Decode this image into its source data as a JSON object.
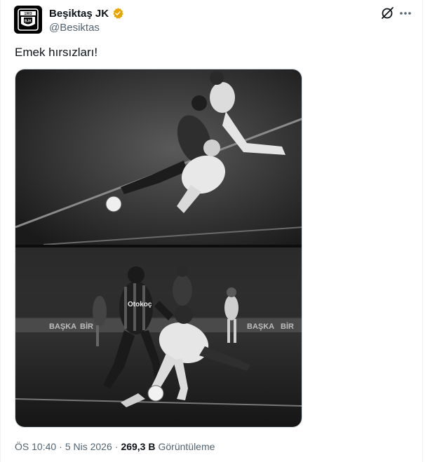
{
  "author": {
    "name": "Beşiktaş JK",
    "handle": "@Besiktas",
    "verified": true,
    "verified_color": "#f2b300"
  },
  "tweet": {
    "text": "Emek hırsızları!"
  },
  "media": {
    "description": "Black and white two-panel football photo collage",
    "crest_text": "BJK",
    "crest_year": "1903",
    "ads": [
      "BAŞKA",
      "BİR",
      "BAŞKA",
      "BİR"
    ],
    "sponsor": "Otokoç"
  },
  "meta": {
    "time": "ÖS 10:40",
    "separator": "·",
    "date": "5 Nis 2026",
    "views_count": "269,3 B",
    "views_label": "Görüntüleme"
  },
  "icons": {
    "grok": "grok-icon",
    "more": "more-icon",
    "verified": "verified-badge-icon"
  }
}
